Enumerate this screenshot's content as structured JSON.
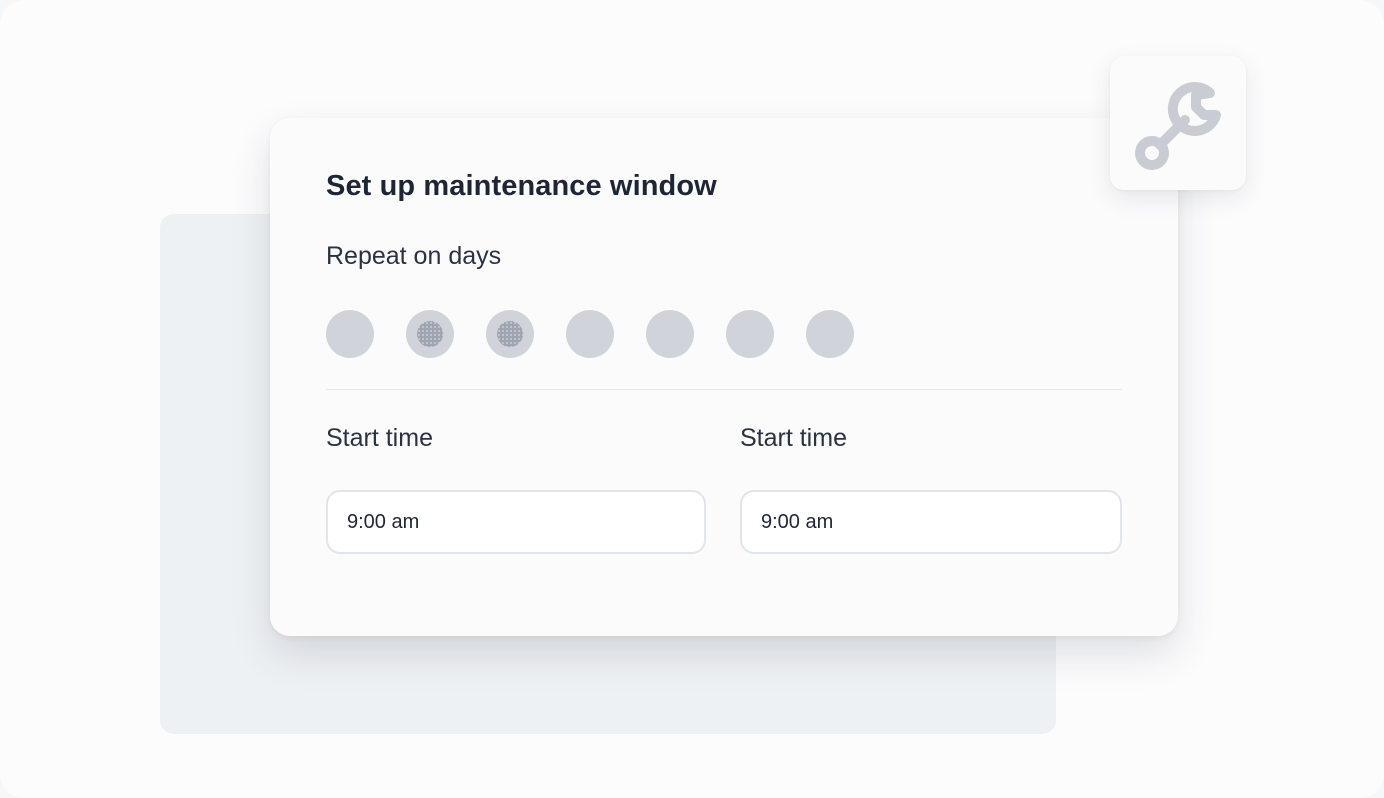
{
  "dialog": {
    "title": "Set up maintenance window",
    "repeat_label": "Repeat on days",
    "days": [
      {
        "selected": false
      },
      {
        "selected": true
      },
      {
        "selected": true
      },
      {
        "selected": false
      },
      {
        "selected": false
      },
      {
        "selected": false
      },
      {
        "selected": false
      }
    ],
    "start_time_1": {
      "label": "Start time",
      "value": "9:00 am"
    },
    "start_time_2": {
      "label": "Start time",
      "value": "9:00 am"
    }
  },
  "badge": {
    "icon": "wrench-icon"
  },
  "colors": {
    "day_unselected": "#d0d4da",
    "day_selected_dot": "#9ea5b0",
    "icon_stroke": "#c9cdd3",
    "title": "#1e2636"
  }
}
